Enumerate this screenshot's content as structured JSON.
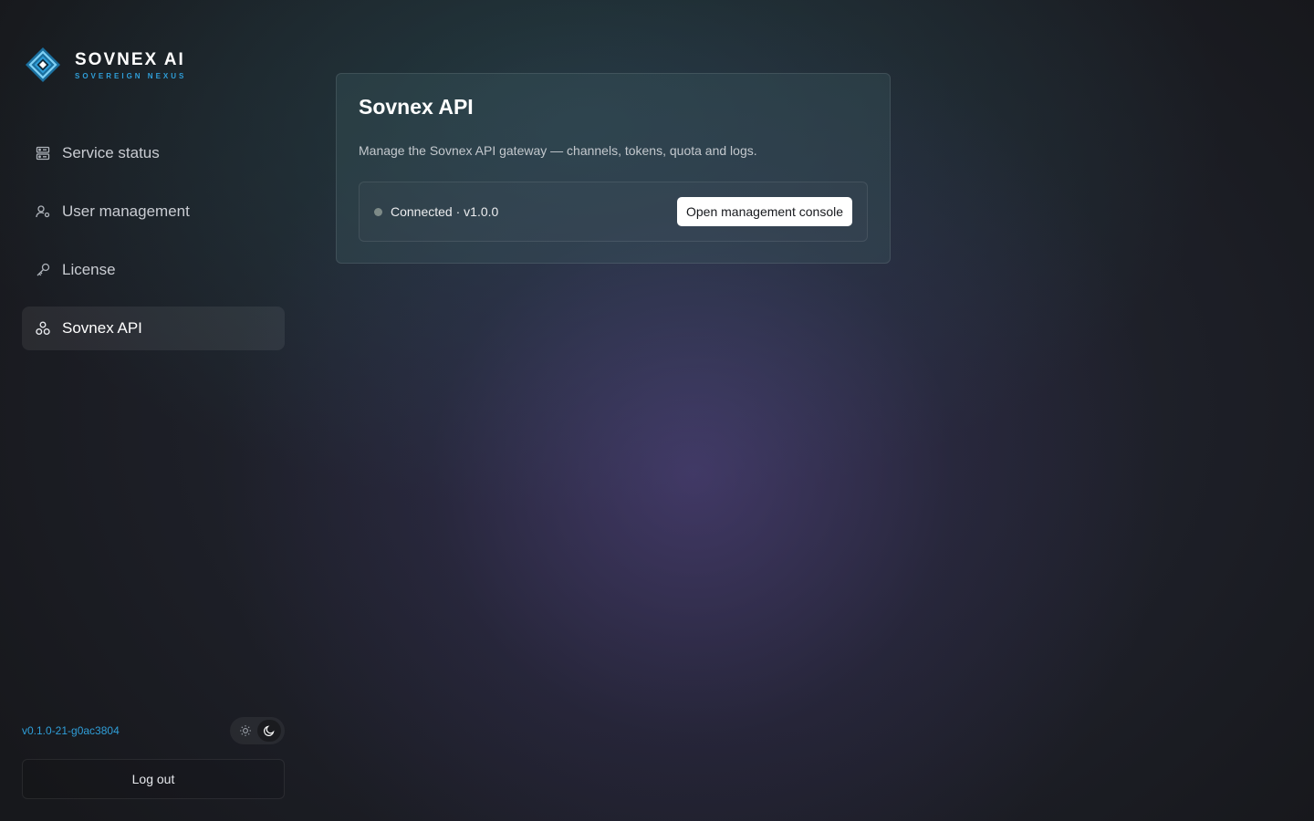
{
  "brand": {
    "name": "SOVNEX AI",
    "tagline": "SOVEREIGN NEXUS",
    "accent_color": "#2f9ed8"
  },
  "sidebar": {
    "items": [
      {
        "label": "Service status",
        "icon": "server-status-icon",
        "active": false
      },
      {
        "label": "User management",
        "icon": "user-settings-icon",
        "active": false
      },
      {
        "label": "License",
        "icon": "key-icon",
        "active": false
      },
      {
        "label": "Sovnex API",
        "icon": "api-nodes-icon",
        "active": true
      }
    ],
    "version": "v0.1.0-21-g0ac3804",
    "theme": {
      "light_icon": "sun-icon",
      "dark_icon": "moon-icon",
      "selected": "dark"
    },
    "logout_label": "Log out"
  },
  "main": {
    "title": "Sovnex API",
    "description": "Manage the Sovnex API gateway — channels, tokens, quota and logs.",
    "status_text": "Connected · v1.0.0",
    "status_color": "#7d8a87",
    "console_button": "Open management console"
  }
}
